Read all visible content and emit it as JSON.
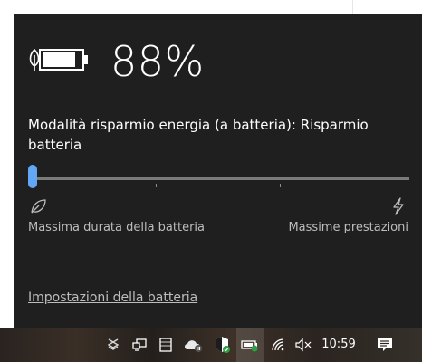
{
  "battery": {
    "percent_text": "88%",
    "charge_level": 0.88,
    "mode_label": "Modalità risparmio energia (a batteria): Risparmio batteria",
    "slider_value": 0,
    "min_caption": "Massima durata della batteria",
    "max_caption": "Massime prestazioni",
    "settings_link": "Impostazioni della batteria"
  },
  "taskbar": {
    "clock": "10:59",
    "icons": [
      "dropbox-icon",
      "network-monitor-icon",
      "tablet-icon",
      "onedrive-icon",
      "security-shield-icon",
      "battery-tray-icon",
      "wifi-icon",
      "volume-muted-icon",
      "notification-icon"
    ]
  },
  "colors": {
    "flyout_bg": "#1f1f1f",
    "accent": "#62a7f5",
    "caption": "#bdbdbd"
  }
}
